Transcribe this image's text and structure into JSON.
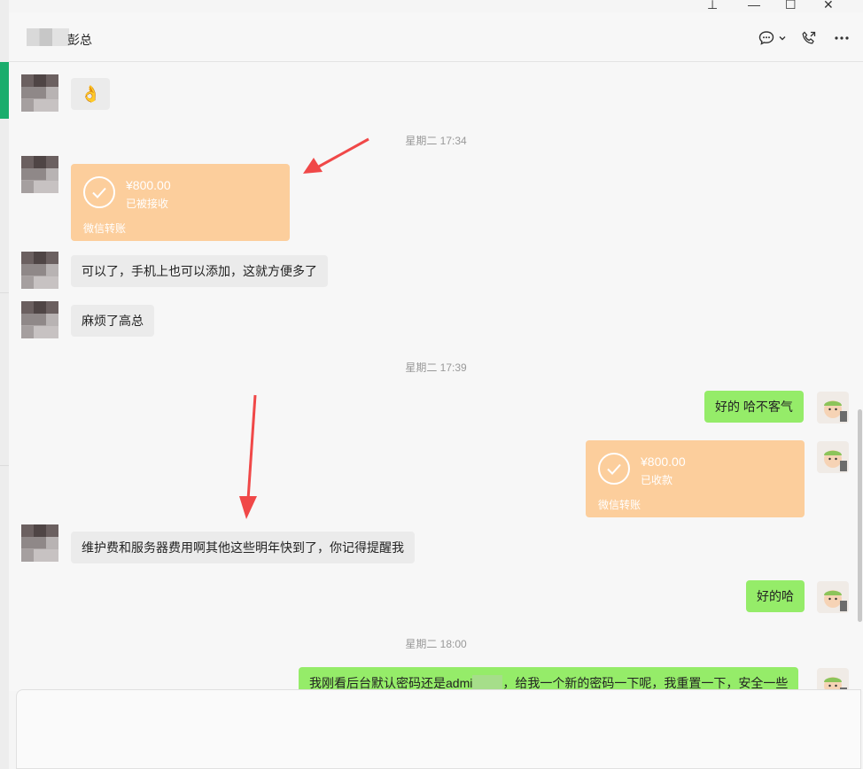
{
  "header": {
    "title": "彭总"
  },
  "window": {
    "pin": "⊥",
    "minimize": "—",
    "maximize": "☐",
    "close": "✕"
  },
  "messages": {
    "emoji": "👌",
    "time1": "星期二 17:34",
    "transfer1": {
      "amount": "¥800.00",
      "state": "已被接收",
      "label": "微信转账"
    },
    "m1": "可以了，手机上也可以添加，这就方便多了",
    "m2": "麻烦了高总",
    "time2": "星期二 17:39",
    "m3": "好的 哈不客气",
    "transfer2": {
      "amount": "¥800.00",
      "state": "已收款",
      "label": "微信转账"
    },
    "m4": "维护费和服务器费用啊其他这些明年快到了，你记得提醒我",
    "m5": "好的哈",
    "time3": "星期二 18:00",
    "m6a": "我刚看后台默认密码还是admi",
    "m6b": "，给我一个新的密码一下呢，我重置一下，安全一些"
  },
  "colors": {
    "accent": "#1aad6c",
    "bubble_self": "#95ec69",
    "bubble_other": "#ebebeb",
    "transfer": "#fcce9c",
    "arrow": "#f04848"
  },
  "icons": [
    "pin-icon",
    "minimize-icon",
    "maximize-icon",
    "close-icon",
    "chat-bubble-icon",
    "chevron-down-icon",
    "phone-icon",
    "more-icon",
    "check-circle-icon"
  ]
}
